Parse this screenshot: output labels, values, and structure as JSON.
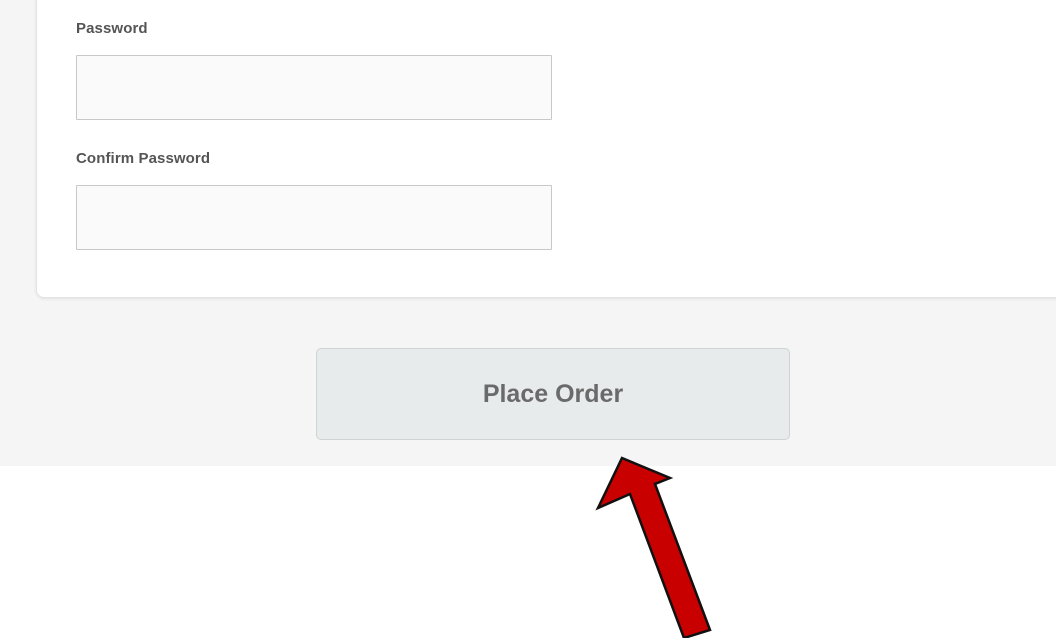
{
  "form": {
    "password": {
      "label": "Password",
      "value": "",
      "placeholder": ""
    },
    "confirm_password": {
      "label": "Confirm Password",
      "value": "",
      "placeholder": ""
    }
  },
  "actions": {
    "place_order_label": "Place Order"
  },
  "annotation": {
    "arrow_icon": "red-arrow-icon",
    "arrow_color": "#c80000"
  }
}
